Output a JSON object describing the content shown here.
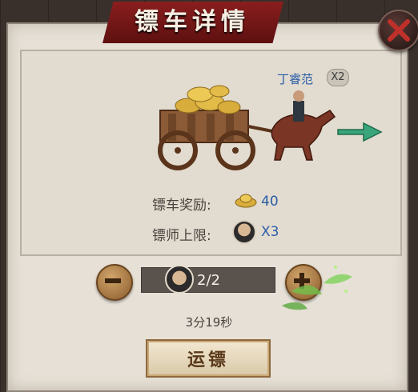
{
  "window": {
    "title": "镖车详情"
  },
  "escort": {
    "name": "丁睿范",
    "multiplier": "X2"
  },
  "rewards": {
    "reward_label": "镖车奖励:",
    "reward_value": "40",
    "escort_limit_label": "镖师上限:",
    "escort_limit_value": "X3"
  },
  "controls": {
    "progress_text": "2/2",
    "timer": "3分19秒",
    "confirm_label": "运镖"
  },
  "icons": {
    "close": "close-icon",
    "ingot": "gold-ingot-icon",
    "avatar": "escort-avatar-icon",
    "minus": "minus-icon",
    "plus": "plus-icon",
    "direction": "arrow-right-icon"
  },
  "colors": {
    "accent_blue": "#2a5ea8",
    "banner_red": "#8a1e1e",
    "arrow_green": "#3aa57a"
  }
}
